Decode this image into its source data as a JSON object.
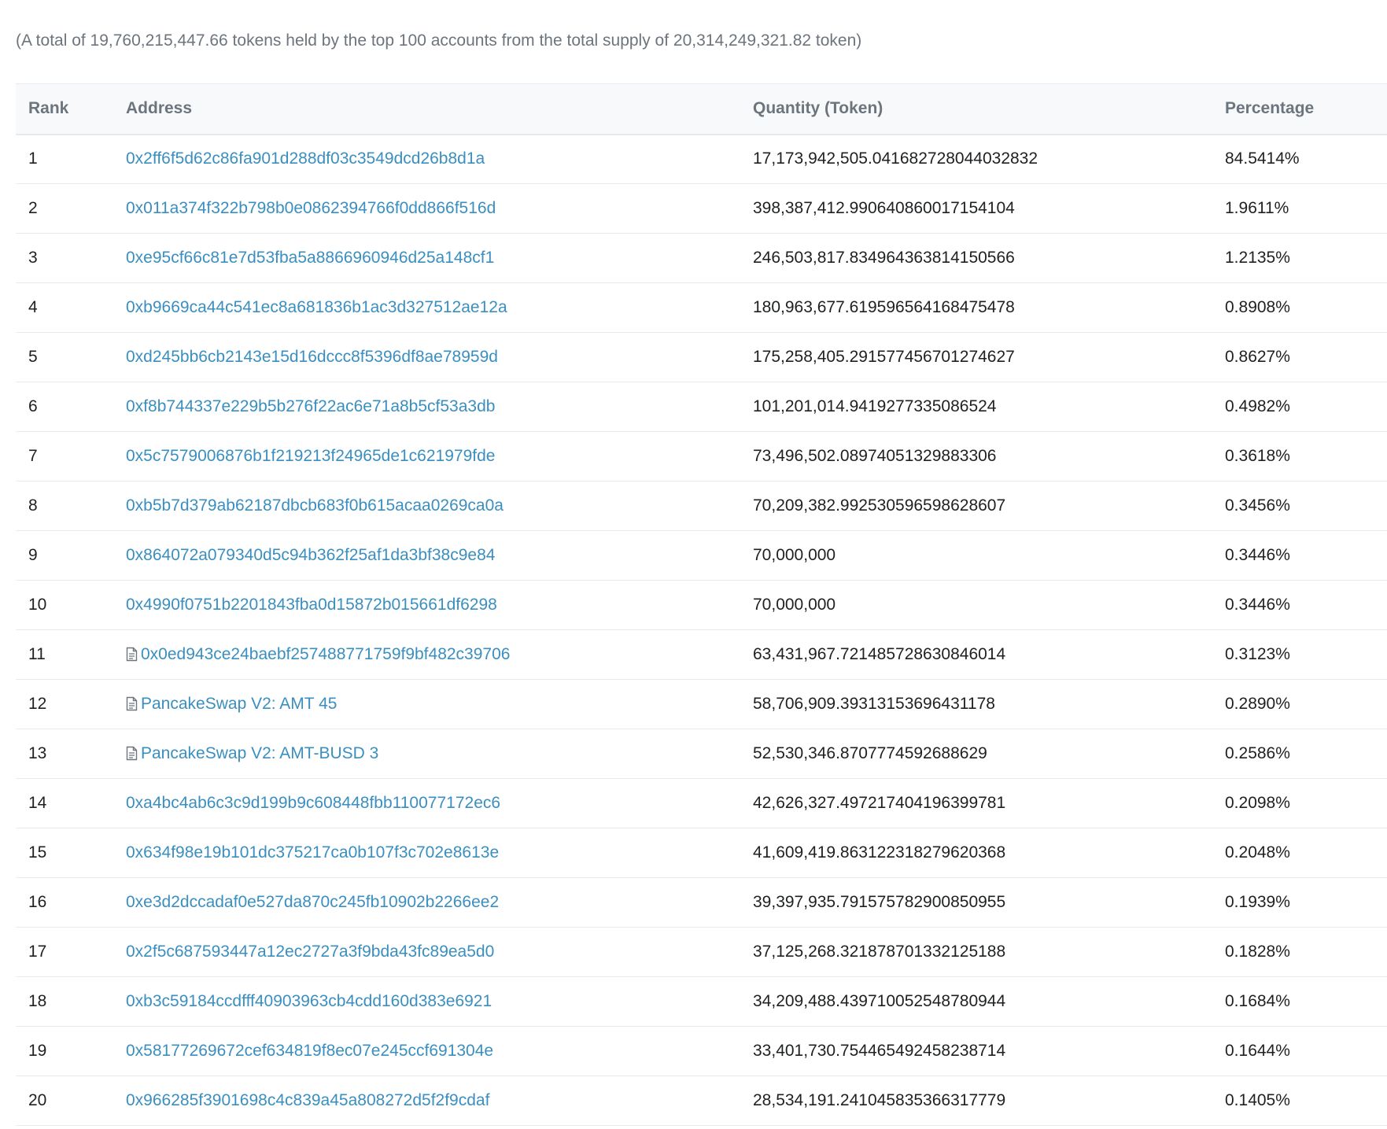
{
  "summary": "(A total of 19,760,215,447.66 tokens held by the top 100 accounts from the total supply of 20,314,249,321.82 token)",
  "colors": {
    "link": "#3a8fc0",
    "header_bg": "#f8f9fa",
    "border": "#e7eaf3",
    "muted_text": "#6c757d"
  },
  "table": {
    "headers": {
      "rank": "Rank",
      "address": "Address",
      "quantity": "Quantity (Token)",
      "percentage": "Percentage"
    },
    "rows": [
      {
        "rank": "1",
        "address": "0x2ff6f5d62c86fa901d288df03c3549dcd26b8d1a",
        "contract": false,
        "quantity": "17,173,942,505.041682728044032832",
        "percentage": "84.5414%"
      },
      {
        "rank": "2",
        "address": "0x011a374f322b798b0e0862394766f0dd866f516d",
        "contract": false,
        "quantity": "398,387,412.990640860017154104",
        "percentage": "1.9611%"
      },
      {
        "rank": "3",
        "address": "0xe95cf66c81e7d53fba5a8866960946d25a148cf1",
        "contract": false,
        "quantity": "246,503,817.834964363814150566",
        "percentage": "1.2135%"
      },
      {
        "rank": "4",
        "address": "0xb9669ca44c541ec8a681836b1ac3d327512ae12a",
        "contract": false,
        "quantity": "180,963,677.619596564168475478",
        "percentage": "0.8908%"
      },
      {
        "rank": "5",
        "address": "0xd245bb6cb2143e15d16dccc8f5396df8ae78959d",
        "contract": false,
        "quantity": "175,258,405.291577456701274627",
        "percentage": "0.8627%"
      },
      {
        "rank": "6",
        "address": "0xf8b744337e229b5b276f22ac6e71a8b5cf53a3db",
        "contract": false,
        "quantity": "101,201,014.9419277335086524",
        "percentage": "0.4982%"
      },
      {
        "rank": "7",
        "address": "0x5c7579006876b1f219213f24965de1c621979fde",
        "contract": false,
        "quantity": "73,496,502.08974051329883306",
        "percentage": "0.3618%"
      },
      {
        "rank": "8",
        "address": "0xb5b7d379ab62187dbcb683f0b615acaa0269ca0a",
        "contract": false,
        "quantity": "70,209,382.992530596598628607",
        "percentage": "0.3456%"
      },
      {
        "rank": "9",
        "address": "0x864072a079340d5c94b362f25af1da3bf38c9e84",
        "contract": false,
        "quantity": "70,000,000",
        "percentage": "0.3446%"
      },
      {
        "rank": "10",
        "address": "0x4990f0751b2201843fba0d15872b015661df6298",
        "contract": false,
        "quantity": "70,000,000",
        "percentage": "0.3446%"
      },
      {
        "rank": "11",
        "address": "0x0ed943ce24baebf257488771759f9bf482c39706",
        "contract": true,
        "quantity": "63,431,967.721485728630846014",
        "percentage": "0.3123%"
      },
      {
        "rank": "12",
        "address": "PancakeSwap V2: AMT 45",
        "contract": true,
        "quantity": "58,706,909.39313153696431178",
        "percentage": "0.2890%"
      },
      {
        "rank": "13",
        "address": "PancakeSwap V2: AMT-BUSD 3",
        "contract": true,
        "quantity": "52,530,346.8707774592688629",
        "percentage": "0.2586%"
      },
      {
        "rank": "14",
        "address": "0xa4bc4ab6c3c9d199b9c608448fbb110077172ec6",
        "contract": false,
        "quantity": "42,626,327.497217404196399781",
        "percentage": "0.2098%"
      },
      {
        "rank": "15",
        "address": "0x634f98e19b101dc375217ca0b107f3c702e8613e",
        "contract": false,
        "quantity": "41,609,419.863122318279620368",
        "percentage": "0.2048%"
      },
      {
        "rank": "16",
        "address": "0xe3d2dccadaf0e527da870c245fb10902b2266ee2",
        "contract": false,
        "quantity": "39,397,935.791575782900850955",
        "percentage": "0.1939%"
      },
      {
        "rank": "17",
        "address": "0x2f5c687593447a12ec2727a3f9bda43fc89ea5d0",
        "contract": false,
        "quantity": "37,125,268.321878701332125188",
        "percentage": "0.1828%"
      },
      {
        "rank": "18",
        "address": "0xb3c59184ccdfff40903963cb4cdd160d383e6921",
        "contract": false,
        "quantity": "34,209,488.439710052548780944",
        "percentage": "0.1684%"
      },
      {
        "rank": "19",
        "address": "0x58177269672cef634819f8ec07e245ccf691304e",
        "contract": false,
        "quantity": "33,401,730.754465492458238714",
        "percentage": "0.1644%"
      },
      {
        "rank": "20",
        "address": "0x966285f3901698c4c839a45a808272d5f2f9cdaf",
        "contract": false,
        "quantity": "28,534,191.241045835366317779",
        "percentage": "0.1405%"
      }
    ]
  }
}
